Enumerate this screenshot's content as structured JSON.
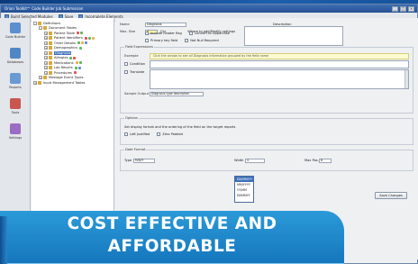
{
  "window": {
    "title": "Orion Toolkit™ Code Builder Job Submission",
    "controls": [
      "_",
      "□",
      "×"
    ]
  },
  "toolbar": {
    "items": [
      "Build Selected Modules",
      "Save",
      "Incomplete Elements"
    ]
  },
  "nav": {
    "buttons": [
      {
        "label": "Code Builder",
        "icon": "code-builder-icon",
        "color": "#5b8fcf"
      },
      {
        "label": "Databases",
        "icon": "database-icon",
        "color": "#4f87c4"
      },
      {
        "label": "Reports",
        "icon": "reports-icon",
        "color": "#6a9ad3"
      },
      {
        "label": "Tools",
        "icon": "tools-icon",
        "color": "#c9564f"
      },
      {
        "label": "Settings",
        "icon": "settings-icon",
        "color": "#9b6cc4"
      }
    ]
  },
  "tree": {
    "rows": [
      {
        "indent": 0,
        "label": "Definitions",
        "exp": "-",
        "dots": []
      },
      {
        "indent": 1,
        "label": "Document Tables",
        "exp": "-",
        "dots": []
      },
      {
        "indent": 2,
        "label": "Patient Table",
        "exp": "+",
        "dots": [
          "#e05050",
          "#5cb85c"
        ]
      },
      {
        "indent": 2,
        "label": "Patient Identifiers",
        "exp": "+",
        "dots": [
          "#e05050",
          "#5cb85c",
          "#f0ad4e"
        ]
      },
      {
        "indent": 2,
        "label": "Order Details",
        "exp": "+",
        "dots": [
          "#5cb85c",
          "#f0ad4e",
          "#5b8fcf"
        ]
      },
      {
        "indent": 2,
        "label": "Demographics",
        "exp": "+",
        "dots": [
          "#5cb85c"
        ]
      },
      {
        "indent": 2,
        "label": "Diagnosis",
        "exp": "+",
        "dots": [],
        "selected": true
      },
      {
        "indent": 2,
        "label": "Allergies",
        "exp": "+",
        "dots": [
          "#5cb85c",
          "#e05050"
        ]
      },
      {
        "indent": 2,
        "label": "Medications",
        "exp": "+",
        "dots": [
          "#f0ad4e",
          "#5cb85c"
        ]
      },
      {
        "indent": 2,
        "label": "Lab Results",
        "exp": "+",
        "dots": [
          "#5cb85c",
          "#5b8fcf"
        ]
      },
      {
        "indent": 2,
        "label": "Procedures",
        "exp": "+",
        "dots": [
          "#e05050"
        ]
      },
      {
        "indent": 1,
        "label": "Message Event Types",
        "exp": "+",
        "dots": []
      },
      {
        "indent": 0,
        "label": "Input Management Tables",
        "exp": "+",
        "dots": []
      }
    ]
  },
  "form": {
    "name_label": "Name",
    "name_value": "Diagnosis",
    "description_label": "Description",
    "max_label": "Max. Size",
    "max_value": "4",
    "max_unit": "Chr",
    "checks_left": [
      "Include header flag",
      "Primary key field"
    ],
    "checks_right_title": "Where to add/Modify settings",
    "checks_right": [
      "Convert to Uppercase",
      "Not Null Required"
    ],
    "format_group": "Field Expressions",
    "format_label": "Example",
    "format_hint": "Click the arrows to see all Diagnosis information grouped by the field name",
    "expr1": "Condition",
    "expr2": "Translate",
    "sample_label": "Sample Output",
    "sample_value": "Diagnosis type description",
    "options_group": "Options",
    "options_text": "Set display format and the ordering of the field on the target reports",
    "opt_checks": [
      "Left Justified",
      "Zero Padded"
    ],
    "date_group": "Date Format",
    "type_label": "Type",
    "type_value": "M/D/Y",
    "width_label": "Width",
    "width_value": "4",
    "dropdown_options": [
      "DD/MM/YY",
      "MM/YYYY",
      "YY/MM",
      "DDMMYY"
    ],
    "maxpos_label": "Max Pos.",
    "maxpos_value": "8",
    "save_label": "Save Changes"
  },
  "banner": {
    "line1": "COST EFFECTIVE AND",
    "line2": "AFFORDABLE"
  }
}
